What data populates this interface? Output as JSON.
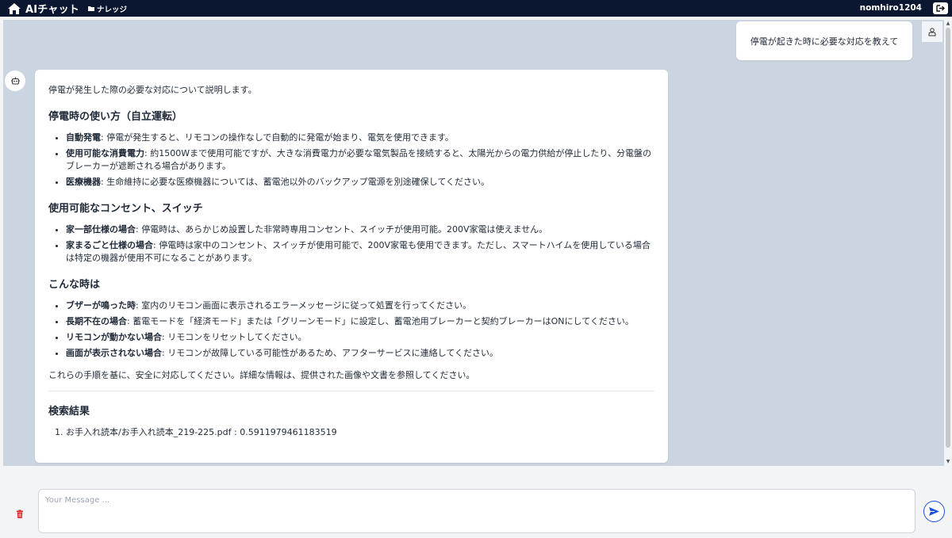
{
  "header": {
    "app_title": "AIチャット",
    "nav_knowledge_label": "ナレッジ",
    "user_name": "nomhiro1204"
  },
  "chat": {
    "user_message": "停電が起きた時に必要な対応を教えて",
    "bot": {
      "intro": "停電が発生した際の必要な対応について説明します。",
      "sections": [
        {
          "heading": "停電時の使い方（自立運転）",
          "items": [
            {
              "term": "自動発電",
              "text": ": 停電が発生すると、リモコンの操作なしで自動的に発電が始まり、電気を使用できます。"
            },
            {
              "term": "使用可能な消費電力",
              "text": ": 約1500Wまで使用可能ですが、大きな消費電力が必要な電気製品を接続すると、太陽光からの電力供給が停止したり、分電盤のブレーカーが遮断される場合があります。"
            },
            {
              "term": "医療機器",
              "text": ": 生命維持に必要な医療機器については、蓄電池以外のバックアップ電源を別途確保してください。"
            }
          ]
        },
        {
          "heading": "使用可能なコンセント、スイッチ",
          "items": [
            {
              "term": "家一部仕様の場合",
              "text": ": 停電時は、あらかじめ設置した非常時専用コンセント、スイッチが使用可能。200V家電は使えません。"
            },
            {
              "term": "家まるごと仕様の場合",
              "text": ": 停電時は家中のコンセント、スイッチが使用可能で、200V家電も使用できます。ただし、スマートハイムを使用している場合は特定の機器が使用不可になることがあります。"
            }
          ]
        },
        {
          "heading": "こんな時は",
          "items": [
            {
              "term": "ブザーが鳴った時",
              "text": ": 室内のリモコン画面に表示されるエラーメッセージに従って処置を行ってください。"
            },
            {
              "term": "長期不在の場合",
              "text": ": 蓄電モードを「経済モード」または「グリーンモード」に設定し、蓄電池用ブレーカーと契約ブレーカーはONにしてください。"
            },
            {
              "term": "リモコンが動かない場合",
              "text": ": リモコンをリセットしてください。"
            },
            {
              "term": "画面が表示されない場合",
              "text": ": リモコンが故障している可能性があるため、アフターサービスに連絡してください。"
            }
          ]
        }
      ],
      "outro": "これらの手順を基に、安全に対応してください。詳細な情報は、提供された画像や文書を参照してください。",
      "search_heading": "検索結果",
      "search_results": [
        "お手入れ読本/お手入れ読本_219-225.pdf : 0.5911979461183519"
      ]
    }
  },
  "input": {
    "placeholder": "Your Message ..."
  },
  "colors": {
    "topbar": "#0b1730",
    "chat_bg": "#cbd5e1",
    "send_accent": "#1d4ed8",
    "trash": "#dc2626"
  }
}
